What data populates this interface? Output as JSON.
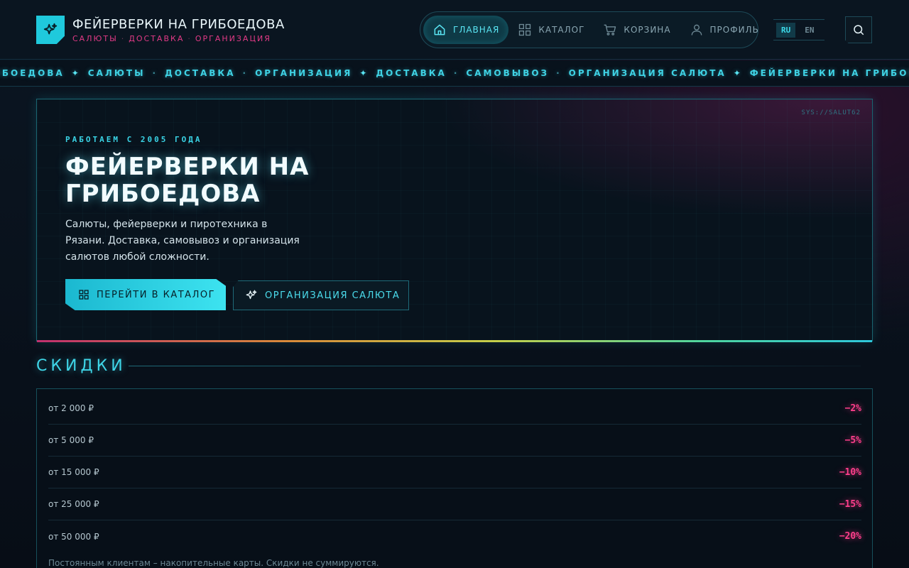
{
  "brand": {
    "title": "ФЕЙЕРВЕРКИ НА ГРИБОЕДОВА",
    "tags": [
      "САЛЮТЫ",
      "ДОСТАВКА",
      "ОРГАНИЗАЦИЯ"
    ],
    "logo_icon": "sparkle-icon"
  },
  "nav": {
    "items": [
      {
        "label": "ГЛАВНАЯ",
        "icon": "home-icon",
        "active": true
      },
      {
        "label": "КАТАЛОГ",
        "icon": "grid-icon",
        "active": false
      },
      {
        "label": "КОРЗИНА",
        "icon": "cart-icon",
        "active": false
      },
      {
        "label": "ПРОФИЛЬ",
        "icon": "user-icon",
        "active": false
      }
    ]
  },
  "lang": {
    "options": [
      "RU",
      "EN"
    ],
    "selected": "RU"
  },
  "search": {
    "icon": "search-icon"
  },
  "ticker": {
    "items": [
      "РИБОЕДОВА",
      "САЛЮТЫ",
      "ДОСТАВКА",
      "ОРГАНИЗАЦИЯ",
      "ДОСТАВКА",
      "САМОВЫВОЗ",
      "ОРГАНИЗАЦИЯ САЛЮТА",
      "ФЕЙЕРВЕРКИ НА ГРИБОЕДОВА"
    ]
  },
  "hero": {
    "sys_tag": "SYS://SALUT62",
    "kicker": "РАБОТАЕМ С 2005 ГОДА",
    "title": "ФЕЙЕРВЕРКИ НА ГРИБОЕДОВА",
    "description": "Салюты, фейерверки и пиротехника в Рязани. Доставка, самовывоз и организация салютов любой сложности.",
    "primary_button": "ПЕРЕЙТИ В КАТАЛОГ",
    "secondary_button": "ОРГАНИЗАЦИЯ САЛЮТА"
  },
  "discounts": {
    "title": "СКИДКИ",
    "rows": [
      {
        "label": "от 2 000 ₽",
        "value": "−2%"
      },
      {
        "label": "от 5 000 ₽",
        "value": "−5%"
      },
      {
        "label": "от 15 000 ₽",
        "value": "−10%"
      },
      {
        "label": "от 25 000 ₽",
        "value": "−15%"
      },
      {
        "label": "от 50 000 ₽",
        "value": "−20%"
      }
    ],
    "note": "Постоянным клиентам – накопительные карты. Скидки не суммируются."
  },
  "colors": {
    "accent_cyan": "#3fd6e8",
    "accent_pink": "#ff3f8c",
    "background": "#070d16"
  }
}
